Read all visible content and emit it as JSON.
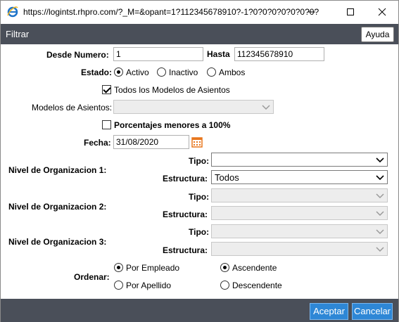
{
  "window": {
    "title": "https://logintst.rhpro.com/?_M=&opant=1?112345678910?-1?0?0?0?0?0?0?0?"
  },
  "header": {
    "title": "Filtrar",
    "help_label": "Ayuda"
  },
  "form": {
    "desde_label": "Desde Numero:",
    "desde_value": "1",
    "hasta_label": "Hasta",
    "hasta_value": "112345678910",
    "estado_label": "Estado:",
    "estado_options": [
      "Activo",
      "Inactivo",
      "Ambos"
    ],
    "estado_selected": "Activo",
    "todos_modelos_label": "Todos los Modelos de Asientos",
    "todos_modelos_checked": true,
    "modelos_label": "Modelos de Asientos:",
    "porcentajes_label": "Porcentajes menores a 100%",
    "porcentajes_checked": false,
    "fecha_label": "Fecha:",
    "fecha_value": "31/08/2020",
    "nivel1_label": "Nivel de Organizacion 1:",
    "nivel2_label": "Nivel de Organizacion 2:",
    "nivel3_label": "Nivel de Organizacion 3:",
    "tipo_label": "Tipo:",
    "estructura_label": "Estructura:",
    "nivel1_tipo_value": "",
    "nivel1_estructura_value": "Todos",
    "ordenar_label": "Ordenar:",
    "ordenar_by_options": [
      "Por Empleado",
      "Por Apellido"
    ],
    "ordenar_by_selected": "Por Empleado",
    "ordenar_dir_options": [
      "Ascendente",
      "Descendente"
    ],
    "ordenar_dir_selected": "Ascendente"
  },
  "footer": {
    "accept_label": "Aceptar",
    "cancel_label": "Cancelar"
  },
  "colors": {
    "header_bg": "#4a4f59",
    "button_blue": "#2e87d6",
    "calendar_orange": "#e8761c"
  }
}
